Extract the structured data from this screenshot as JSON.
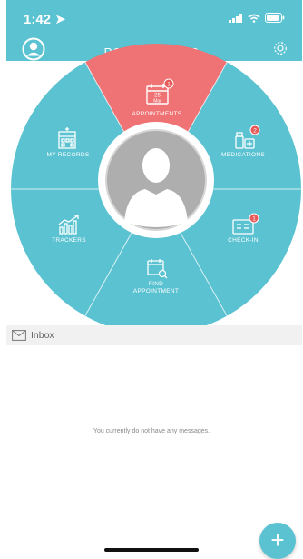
{
  "status": {
    "time": "1:42 ➤"
  },
  "header": {
    "title": "ROBERT MYLES"
  },
  "menu": {
    "appointments": {
      "label": "APPOINTMENTS",
      "badge": "1",
      "date_day": "25",
      "date_month": "Mar"
    },
    "medications": {
      "label": "MEDICATIONS",
      "badge": "2"
    },
    "check_in": {
      "label": "CHECK-IN",
      "badge": "1"
    },
    "find_appointment": {
      "line1": "FIND",
      "line2": "APPOINTMENT"
    },
    "trackers": {
      "label": "TRACKERS"
    },
    "my_records": {
      "label": "MY RECORDS"
    }
  },
  "inbox": {
    "label": "Inbox",
    "empty_message": "You currently do not have any messages."
  },
  "fab": {
    "label": "+"
  },
  "colors": {
    "accent": "#5ac2d1",
    "highlight": "#ef7274",
    "badge": "#e85a5a"
  }
}
